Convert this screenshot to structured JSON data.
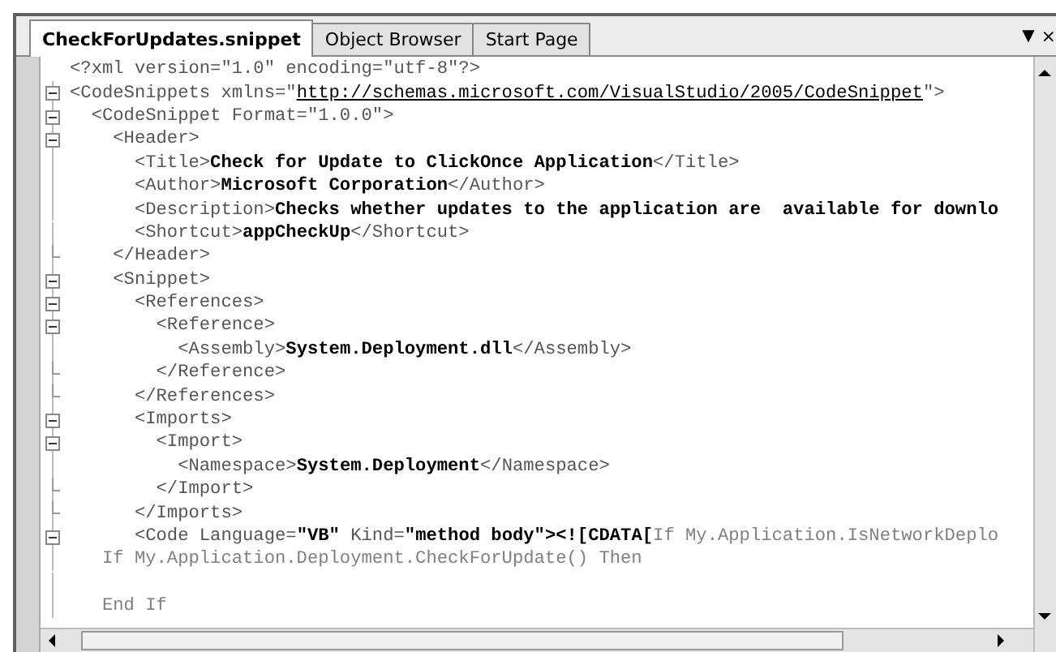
{
  "tabs": [
    {
      "label": "CheckForUpdates.snippet",
      "selected": true
    },
    {
      "label": "Object Browser",
      "selected": false
    },
    {
      "label": "Start Page",
      "selected": false
    }
  ],
  "tab_menu": "▼",
  "tab_close": "×",
  "lines": [
    {
      "kind": "plain",
      "segments": [
        {
          "kind": "tag",
          "text": "<?xml version=\"1.0\" encoding=\"utf-8\"?>"
        }
      ]
    },
    {
      "kind": "collapse",
      "segments": [
        {
          "kind": "tag",
          "text": "<CodeSnippets xmlns=\""
        },
        {
          "kind": "link",
          "text": "http://schemas.microsoft.com/VisualStudio/2005/CodeSnippet"
        },
        {
          "kind": "tag",
          "text": "\">"
        }
      ]
    },
    {
      "kind": "collapse",
      "segments": [
        {
          "kind": "tag",
          "text": "  <CodeSnippet Format=\"1.0.0\">"
        }
      ]
    },
    {
      "kind": "collapse",
      "segments": [
        {
          "kind": "tag",
          "text": "    <Header>"
        }
      ]
    },
    {
      "kind": "plain",
      "segments": [
        {
          "kind": "tag",
          "text": "      <Title>"
        },
        {
          "kind": "value",
          "text": "Check for Update to ClickOnce Application"
        },
        {
          "kind": "tag",
          "text": "</Title>"
        }
      ]
    },
    {
      "kind": "plain",
      "segments": [
        {
          "kind": "tag",
          "text": "      <Author>"
        },
        {
          "kind": "value",
          "text": "Microsoft Corporation"
        },
        {
          "kind": "tag",
          "text": "</Author>"
        }
      ]
    },
    {
      "kind": "plain",
      "segments": [
        {
          "kind": "tag",
          "text": "      <Description>"
        },
        {
          "kind": "value",
          "text": "Checks whether updates to the application are  available for downlo"
        }
      ]
    },
    {
      "kind": "plain",
      "segments": [
        {
          "kind": "tag",
          "text": "      <Shortcut>"
        },
        {
          "kind": "value",
          "text": "appCheckUp"
        },
        {
          "kind": "tag",
          "text": "</Shortcut>"
        }
      ]
    },
    {
      "kind": "end",
      "segments": [
        {
          "kind": "tag",
          "text": "    </Header>"
        }
      ]
    },
    {
      "kind": "collapse",
      "segments": [
        {
          "kind": "tag",
          "text": "    <Snippet>"
        }
      ]
    },
    {
      "kind": "collapse",
      "segments": [
        {
          "kind": "tag",
          "text": "      <References>"
        }
      ]
    },
    {
      "kind": "collapse",
      "segments": [
        {
          "kind": "tag",
          "text": "        <Reference>"
        }
      ]
    },
    {
      "kind": "plain",
      "segments": [
        {
          "kind": "tag",
          "text": "          <Assembly>"
        },
        {
          "kind": "value",
          "text": "System.Deployment.dll"
        },
        {
          "kind": "tag",
          "text": "</Assembly>"
        }
      ]
    },
    {
      "kind": "end",
      "segments": [
        {
          "kind": "tag",
          "text": "        </Reference>"
        }
      ]
    },
    {
      "kind": "end",
      "segments": [
        {
          "kind": "tag",
          "text": "      </References>"
        }
      ]
    },
    {
      "kind": "collapse",
      "segments": [
        {
          "kind": "tag",
          "text": "      <Imports>"
        }
      ]
    },
    {
      "kind": "collapse",
      "segments": [
        {
          "kind": "tag",
          "text": "        <Import>"
        }
      ]
    },
    {
      "kind": "plain",
      "segments": [
        {
          "kind": "tag",
          "text": "          <Namespace>"
        },
        {
          "kind": "value",
          "text": "System.Deployment"
        },
        {
          "kind": "tag",
          "text": "</Namespace>"
        }
      ]
    },
    {
      "kind": "end",
      "segments": [
        {
          "kind": "tag",
          "text": "        </Import>"
        }
      ]
    },
    {
      "kind": "end",
      "segments": [
        {
          "kind": "tag",
          "text": "      </Imports>"
        }
      ]
    },
    {
      "kind": "collapse",
      "segments": [
        {
          "kind": "tag",
          "text": "      <Code Language="
        },
        {
          "kind": "value",
          "text": "\"VB\""
        },
        {
          "kind": "tag",
          "text": " Kind="
        },
        {
          "kind": "value",
          "text": "\"method body\""
        },
        {
          "kind": "value",
          "text": "><![CDATA["
        },
        {
          "kind": "code",
          "text": "If My.Application.IsNetworkDeplo"
        }
      ]
    },
    {
      "kind": "plain",
      "segments": [
        {
          "kind": "code",
          "text": "   If My.Application.Deployment.CheckForUpdate() Then"
        }
      ]
    },
    {
      "kind": "plain"
    },
    {
      "kind": "plain",
      "segments": [
        {
          "kind": "code",
          "text": "   End If"
        }
      ]
    }
  ]
}
